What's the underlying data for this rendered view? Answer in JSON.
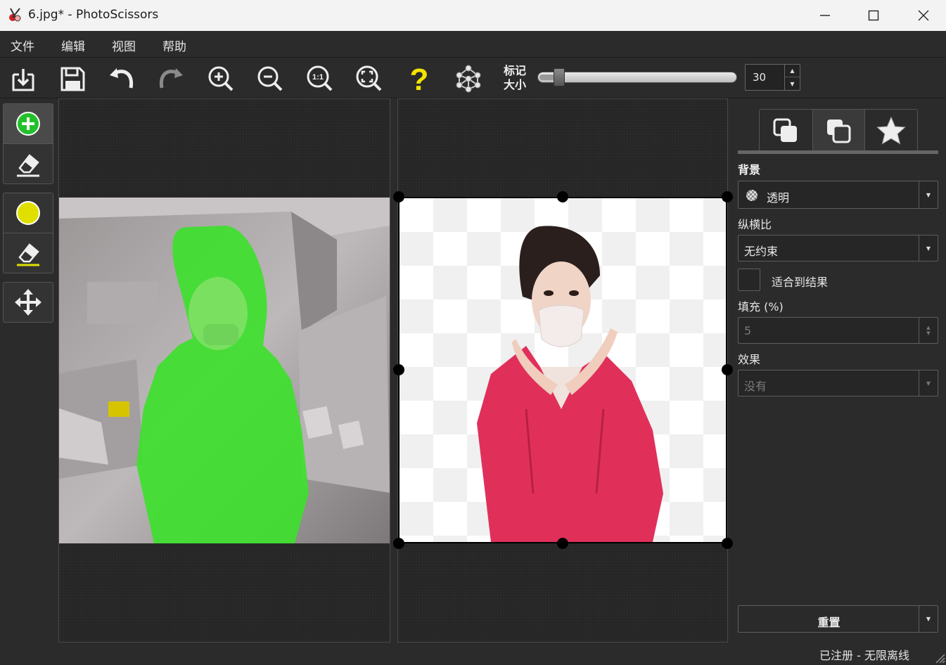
{
  "window": {
    "title": "6.jpg* - PhotoScissors",
    "minimize_icon": "minimize-icon",
    "maximize_icon": "maximize-icon",
    "close_icon": "close-icon"
  },
  "menu": [
    "文件",
    "编辑",
    "视图",
    "帮助"
  ],
  "toolbar": {
    "icons": [
      "open-icon",
      "save-icon",
      "undo-icon",
      "redo-icon",
      "zoom-in-icon",
      "zoom-out-icon",
      "zoom-actual-icon",
      "zoom-fit-icon",
      "help-icon",
      "network-icon"
    ],
    "zoom_actual_label": "1:1",
    "help_glyph": "?",
    "marker_label_line1": "标记",
    "marker_label_line2": "大小",
    "marker_size": "30",
    "marker_fraction": 0.08
  },
  "tools": [
    "add-marker-tool",
    "add-eraser-tool",
    "remove-marker-tool",
    "remove-eraser-tool",
    "move-tool"
  ],
  "colors": {
    "add_green": "#22c12a",
    "remove_yellow": "#e0e000",
    "help_yellow": "#f4e400",
    "dress_pink": "#e0305a",
    "green_overlay": "#3ee02e"
  },
  "panel": {
    "tabs": [
      "background-tab",
      "foreground-tab",
      "effects-tab"
    ],
    "background_label": "背景",
    "background_value": "透明",
    "aspect_label": "纵横比",
    "aspect_value": "无约束",
    "fit_label": "适合到结果",
    "fill_label": "填充 (%)",
    "fill_value": "5",
    "effect_label": "效果",
    "effect_value": "没有",
    "reset_label": "重置"
  },
  "status": "已注册 - 无限离线"
}
